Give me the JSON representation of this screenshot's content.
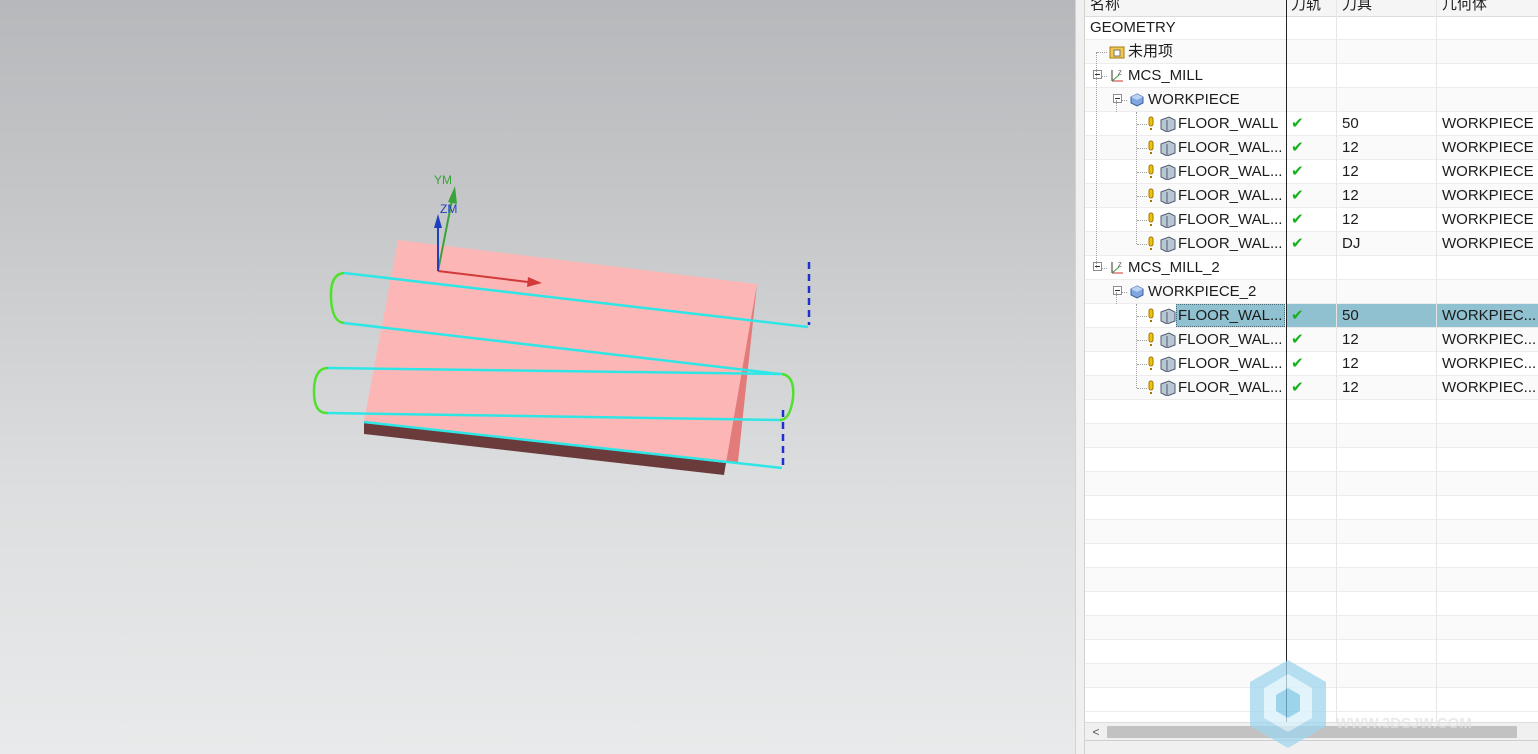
{
  "viewport": {
    "axes": {
      "y_label": "YM",
      "z_label": "ZM"
    },
    "colors": {
      "part_top": "#fdb6b6",
      "part_side": "#e37b7b",
      "part_bottom": "#6b3b3c",
      "toolpath_cut": "#2fe6e6",
      "toolpath_arc": "#4fe12c",
      "toolpath_rapid": "#1f2fd0",
      "axis_x": "#d23a3a",
      "axis_y": "#3aa43a",
      "axis_z": "#1f3fbf"
    }
  },
  "navigator": {
    "columns": {
      "name": "名称",
      "toolpath": "刀轨",
      "tool": "刀具",
      "geometry": "几何体"
    },
    "rows": [
      {
        "name": "GEOMETRY",
        "path": "",
        "tool": "",
        "geom": "",
        "kind": "root"
      },
      {
        "name": "未用项",
        "path": "",
        "tool": "",
        "geom": "",
        "kind": "unused"
      },
      {
        "name": "MCS_MILL",
        "path": "",
        "tool": "",
        "geom": "",
        "kind": "mcs"
      },
      {
        "name": "WORKPIECE",
        "path": "",
        "tool": "",
        "geom": "",
        "kind": "workpiece"
      },
      {
        "name": "FLOOR_WALL",
        "path": "✔",
        "tool": "50",
        "geom": "WORKPIECE",
        "kind": "op"
      },
      {
        "name": "FLOOR_WAL...",
        "path": "✔",
        "tool": "12",
        "geom": "WORKPIECE",
        "kind": "op"
      },
      {
        "name": "FLOOR_WAL...",
        "path": "✔",
        "tool": "12",
        "geom": "WORKPIECE",
        "kind": "op"
      },
      {
        "name": "FLOOR_WAL...",
        "path": "✔",
        "tool": "12",
        "geom": "WORKPIECE",
        "kind": "op"
      },
      {
        "name": "FLOOR_WAL...",
        "path": "✔",
        "tool": "12",
        "geom": "WORKPIECE",
        "kind": "op"
      },
      {
        "name": "FLOOR_WAL...",
        "path": "✔",
        "tool": "DJ",
        "geom": "WORKPIECE",
        "kind": "op"
      },
      {
        "name": "MCS_MILL_2",
        "path": "",
        "tool": "",
        "geom": "",
        "kind": "mcs"
      },
      {
        "name": "WORKPIECE_2",
        "path": "",
        "tool": "",
        "geom": "",
        "kind": "workpiece"
      },
      {
        "name": "FLOOR_WAL...",
        "path": "✔",
        "tool": "50",
        "geom": "WORKPIEC...",
        "kind": "op",
        "selected": true
      },
      {
        "name": "FLOOR_WAL...",
        "path": "✔",
        "tool": "12",
        "geom": "WORKPIEC...",
        "kind": "op"
      },
      {
        "name": "FLOOR_WAL...",
        "path": "✔",
        "tool": "12",
        "geom": "WORKPIEC...",
        "kind": "op"
      },
      {
        "name": "FLOOR_WAL...",
        "path": "✔",
        "tool": "12",
        "geom": "WORKPIEC...",
        "kind": "op"
      }
    ],
    "scroll_left_glyph": "<",
    "selection_color": "#8fc1d0"
  },
  "watermark": {
    "text": "WWW.3DSJW.COM"
  }
}
